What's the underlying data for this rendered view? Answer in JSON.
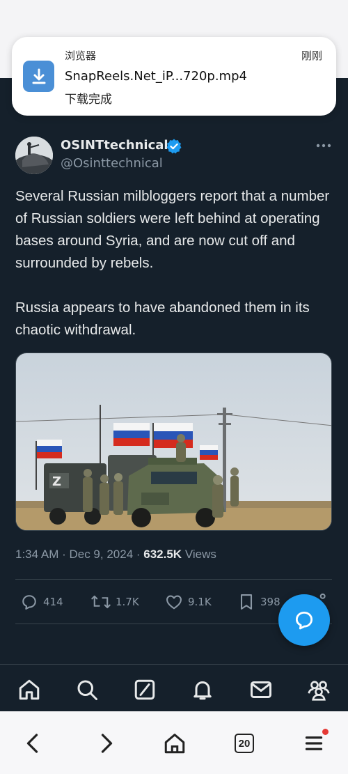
{
  "notification": {
    "app_name": "浏览器",
    "time": "刚刚",
    "title": "SnapReels.Net_iP...720p.mp4",
    "status": "下载完成",
    "icon": "download-icon"
  },
  "tweet": {
    "author_name": "OSINTtechnical",
    "author_handle": "@Osinttechnical",
    "verified": true,
    "text": "Several Russian milbloggers report that a number of Russian soldiers were left behind at operating bases around Syria, and are now cut off and surrounded by rebels.\n\nRussia appears to have abandoned them in its chaotic withdrawal.",
    "timestamp": "1:34 AM · Dec 9, 2024 · ",
    "views_count": "632.5K",
    "views_label": " Views"
  },
  "actions": {
    "replies": "414",
    "reposts": "1.7K",
    "likes": "9.1K",
    "bookmarks": "398"
  },
  "nav_icons": [
    "home-icon",
    "search-icon",
    "grok-icon",
    "notifications-icon",
    "messages-icon",
    "communities-icon"
  ],
  "browser": {
    "tab_count": "20"
  },
  "colors": {
    "background": "#15202b",
    "accent": "#1d9bf0",
    "muted_text": "#8b98a5",
    "primary_text": "#e7e9ea"
  }
}
